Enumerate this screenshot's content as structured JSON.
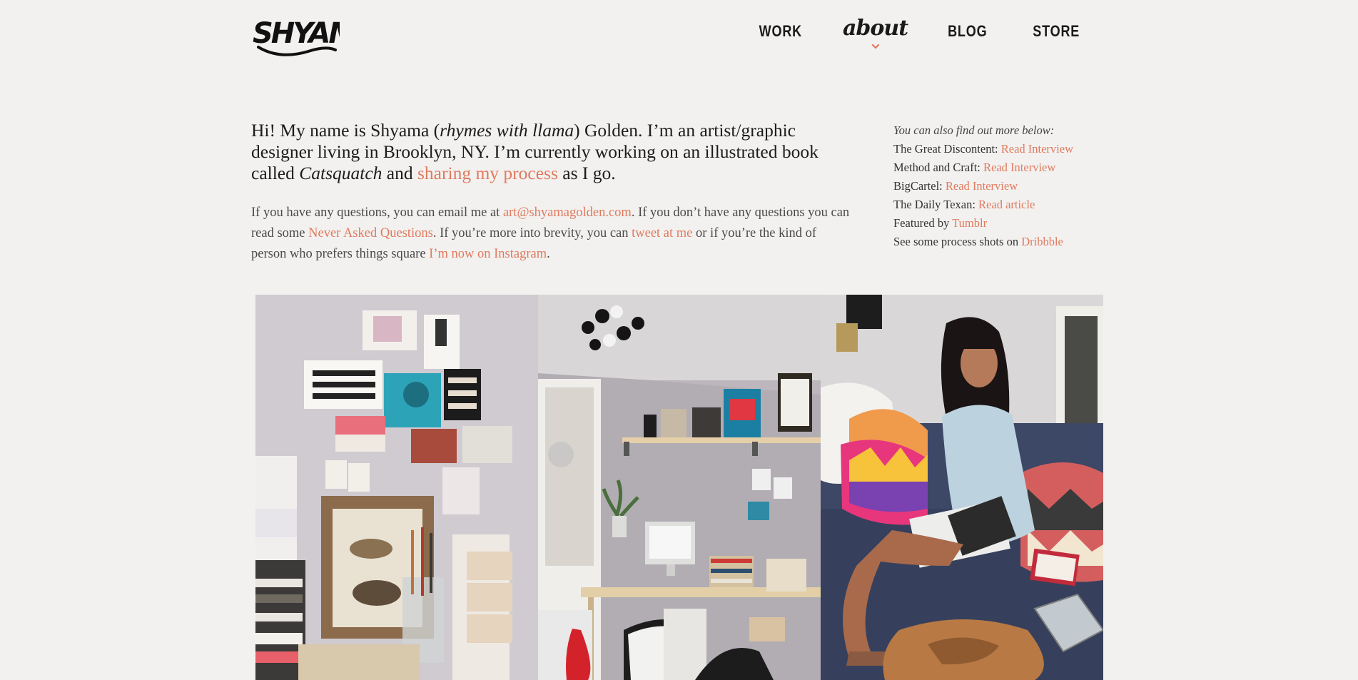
{
  "site": {
    "logo_text": "SHYAMA"
  },
  "nav": {
    "items": [
      {
        "label": "WORK"
      },
      {
        "label": "about"
      },
      {
        "label": "BLOG"
      },
      {
        "label": "STORE"
      }
    ]
  },
  "intro": {
    "part1": "Hi! My name is Shyama (",
    "rhymes": "rhymes with llama",
    "part2": ") Golden. I’m an artist/graphic designer living in Brooklyn, NY. I’m currently working on an illustrated book called ",
    "book": "Catsquatch",
    "part3": " and ",
    "process_link": "sharing my process",
    "part4": " as I go."
  },
  "contact": {
    "t1": "If you have any questions, you can email me at ",
    "email": "art@shyamagolden.com",
    "t2": ". If you don’t have any questions you can read some ",
    "naq": "Never Asked Questions",
    "t3": ". If you’re more into brevity, you can ",
    "tweet": "tweet at me",
    "t4": " or if you’re the kind of person who prefers things square ",
    "instagram": "I’m now on Instagram",
    "t5": "."
  },
  "sidebar": {
    "lead": "You can also find out more below:",
    "items": [
      {
        "text": "The Great Discontent: ",
        "link": "Read Interview"
      },
      {
        "text": "Method and Craft: ",
        "link": "Read Interview"
      },
      {
        "text": "BigCartel: ",
        "link": "Read Interview"
      },
      {
        "text": "The Daily Texan: ",
        "link": "Read article"
      },
      {
        "text": "Featured by ",
        "link": "Tumblr"
      },
      {
        "text": "See some process shots on ",
        "link": "Dribbble"
      }
    ]
  },
  "colors": {
    "accent": "#e07a5f",
    "background": "#f2f1ef",
    "text": "#222222"
  }
}
